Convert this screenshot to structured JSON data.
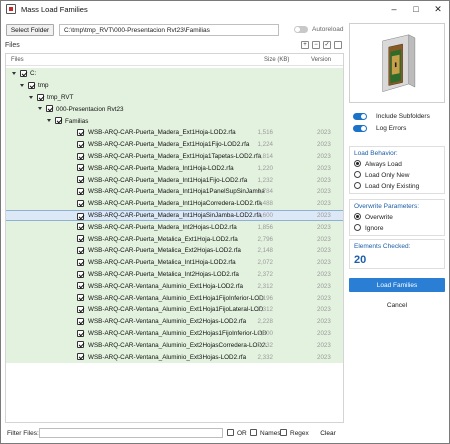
{
  "window": {
    "title": "Mass Load Families"
  },
  "toolbar": {
    "select_folder_label": "Select Folder",
    "path_value": "C:\\tmp\\tmp_RVT\\000-Presentacion Rvt23\\Familias",
    "autoreload_label": "Autoreload"
  },
  "files": {
    "section_title": "Files",
    "columns": {
      "files": "Files",
      "size": "Size (KB)",
      "version": "Version"
    },
    "tree": [
      {
        "label": "C:",
        "size": "",
        "version": ""
      },
      {
        "label": "tmp",
        "size": "",
        "version": ""
      },
      {
        "label": "tmp_RVT",
        "size": "",
        "version": ""
      },
      {
        "label": "000-Presentacion Rvt23",
        "size": "",
        "version": ""
      },
      {
        "label": "Familias",
        "size": "",
        "version": ""
      }
    ],
    "items": [
      {
        "label": "WSB-ARQ-CAR-Puerta_Madera_Ext1Hoja-LOD2.rfa",
        "size": "1,516",
        "version": "2023"
      },
      {
        "label": "WSB-ARQ-CAR-Puerta_Madera_Ext1Hoja1Fijo-LOD2.rfa",
        "size": "1,224",
        "version": "2023"
      },
      {
        "label": "WSB-ARQ-CAR-Puerta_Madera_Ext1Hoja1Tapetas-LOD2.rfa",
        "size": "1,814",
        "version": "2023"
      },
      {
        "label": "WSB-ARQ-CAR-Puerta_Madera_Int1Hoja-LOD2.rfa",
        "size": "1,220",
        "version": "2023"
      },
      {
        "label": "WSB-ARQ-CAR-Puerta_Madera_Int1Hoja1Fijo-LOD2.rfa",
        "size": "1,232",
        "version": "2023"
      },
      {
        "label": "WSB-ARQ-CAR-Puerta_Madera_Int1Hoja1PanelSupSinJamba",
        "size": "1,784",
        "version": "2023"
      },
      {
        "label": "WSB-ARQ-CAR-Puerta_Madera_Int1HojaCorredera-LOD2.rfa",
        "size": "2,488",
        "version": "2023"
      },
      {
        "label": "WSB-ARQ-CAR-Puerta_Madera_Int1HojaSinJamba-LOD2.rfa",
        "size": "1,600",
        "version": "2023"
      },
      {
        "label": "WSB-ARQ-CAR-Puerta_Madera_Int2Hojas-LOD2.rfa",
        "size": "1,856",
        "version": "2023"
      },
      {
        "label": "WSB-ARQ-CAR-Puerta_Metalica_Ext1Hoja-LOD2.rfa",
        "size": "2,796",
        "version": "2023"
      },
      {
        "label": "WSB-ARQ-CAR-Puerta_Metalica_Ext2Hojas-LOD2.rfa",
        "size": "2,148",
        "version": "2023"
      },
      {
        "label": "WSB-ARQ-CAR-Puerta_Metalica_Int1Hoja-LOD2.rfa",
        "size": "2,072",
        "version": "2023"
      },
      {
        "label": "WSB-ARQ-CAR-Puerta_Metalica_Int2Hojas-LOD2.rfa",
        "size": "2,372",
        "version": "2023"
      },
      {
        "label": "WSB-ARQ-CAR-Ventana_Aluminio_Ext1Hoja-LOD2.rfa",
        "size": "2,312",
        "version": "2023"
      },
      {
        "label": "WSB-ARQ-CAR-Ventana_Aluminio_Ext1Hoja1FijoInferior-LOD",
        "size": "2,196",
        "version": "2023"
      },
      {
        "label": "WSB-ARQ-CAR-Ventana_Aluminio_Ext1Hoja1FijoLateral-LOD",
        "size": "2,312",
        "version": "2023"
      },
      {
        "label": "WSB-ARQ-CAR-Ventana_Aluminio_Ext2Hojas-LOD2.rfa",
        "size": "2,228",
        "version": "2023"
      },
      {
        "label": "WSB-ARQ-CAR-Ventana_Aluminio_Ext2Hojas1FijoInferior-LOD",
        "size": "2,300",
        "version": "2023"
      },
      {
        "label": "WSB-ARQ-CAR-Ventana_Aluminio_Ext2HojasCorredera-LOD2.",
        "size": "2,332",
        "version": "2023"
      },
      {
        "label": "WSB-ARQ-CAR-Ventana_Aluminio_Ext3Hojas-LOD2.rfa",
        "size": "2,332",
        "version": "2023"
      }
    ],
    "selected_index": 7
  },
  "filter": {
    "label": "Filter Files:",
    "value": "",
    "or_label": "OR",
    "names_label": "Names",
    "regex_label": "Regex",
    "clear_label": "Clear"
  },
  "options": {
    "include_subfolders_label": "Include Subfolders",
    "log_errors_label": "Log Errors",
    "include_subfolders_on": true,
    "log_errors_on": true
  },
  "load_behavior": {
    "title": "Load Behavior:",
    "options": [
      "Always Load",
      "Load Only New",
      "Load Only Existing"
    ],
    "selected": "Always Load"
  },
  "overwrite": {
    "title": "Overwrite Parameters:",
    "options": [
      "Overwrite",
      "Ignore"
    ],
    "selected": "Overwrite"
  },
  "elements": {
    "title": "Elements Checked:",
    "count": "20"
  },
  "actions": {
    "load_label": "Load Families",
    "cancel_label": "Cancel"
  },
  "colors": {
    "accent": "#2a7fd4",
    "heading_blue": "#1c5ea8",
    "folder_row_green": "#e3f2df",
    "selected_row": "#dde8f6"
  }
}
